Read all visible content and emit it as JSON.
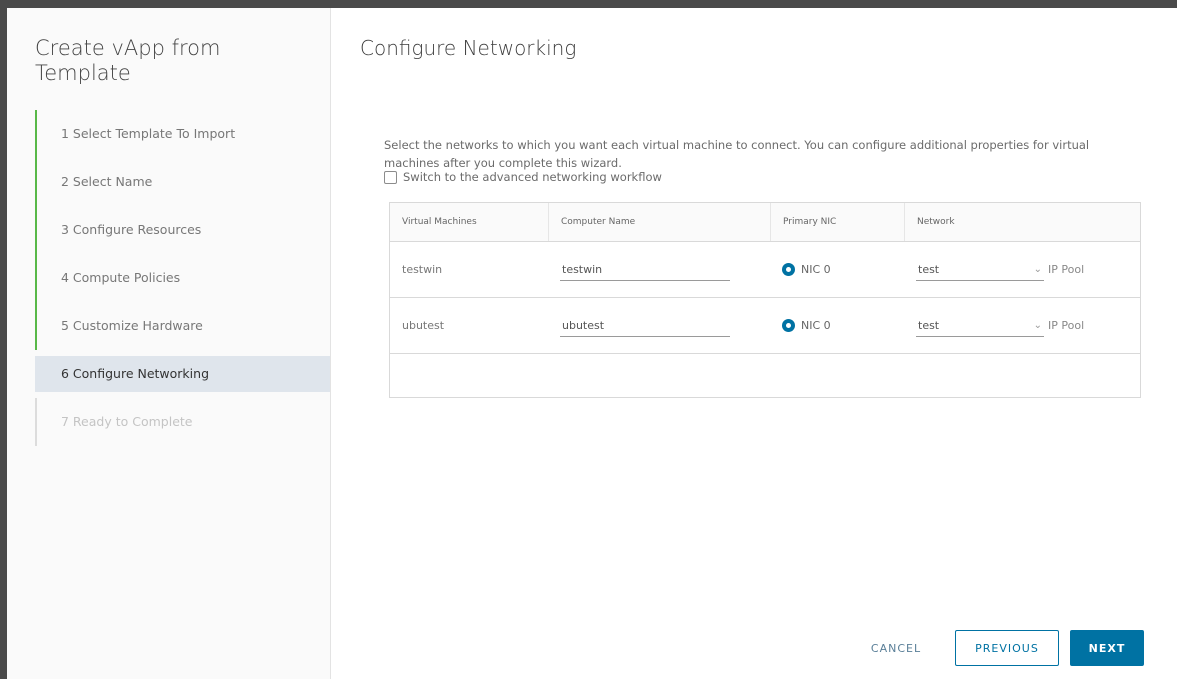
{
  "wizard": {
    "title": "Create vApp from Template",
    "steps": [
      {
        "label": "1  Select Template To Import",
        "state": "done"
      },
      {
        "label": "2  Select Name",
        "state": "done"
      },
      {
        "label": "3  Configure Resources",
        "state": "done"
      },
      {
        "label": "4  Compute Policies",
        "state": "done"
      },
      {
        "label": "5  Customize Hardware",
        "state": "done"
      },
      {
        "label": "6  Configure Networking",
        "state": "active"
      },
      {
        "label": "7  Ready to Complete",
        "state": "disabled"
      }
    ]
  },
  "page": {
    "title": "Configure Networking",
    "description": "Select the networks to which you want each virtual machine to connect. You can configure additional properties for virtual machines after you complete this wizard.",
    "advanced_checkbox_label": "Switch to the advanced networking workflow",
    "advanced_checked": false
  },
  "grid": {
    "columns": [
      "Virtual Machines",
      "Computer Name",
      "Primary NIC",
      "Network"
    ],
    "rows": [
      {
        "vm": "testwin",
        "computer_name": "testwin",
        "nic": "NIC 0",
        "network": "test",
        "ip_mode": "IP Pool"
      },
      {
        "vm": "ubutest",
        "computer_name": "ubutest",
        "nic": "NIC 0",
        "network": "test",
        "ip_mode": "IP Pool"
      }
    ]
  },
  "footer": {
    "cancel": "CANCEL",
    "previous": "PREVIOUS",
    "next": "NEXT"
  },
  "colors": {
    "accent": "#0072a3",
    "step_done": "#58b848",
    "active_step_bg": "#dfe5ec"
  }
}
